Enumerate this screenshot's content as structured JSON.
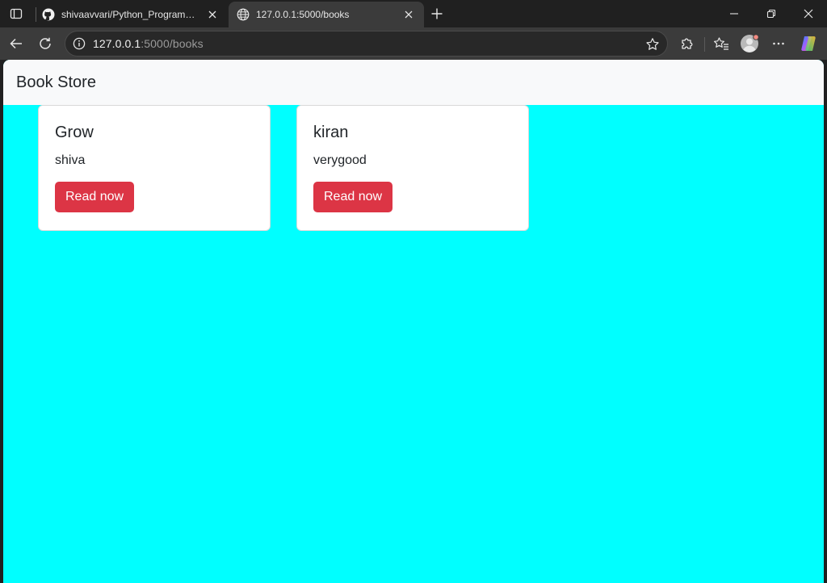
{
  "browser": {
    "tabs": [
      {
        "title": "shivaavvari/Python_Programming",
        "icon": "github-icon",
        "active": false
      },
      {
        "title": "127.0.0.1:5000/books",
        "icon": "globe-icon",
        "active": true
      }
    ],
    "address": {
      "host": "127.0.0.1",
      "path": ":5000/books"
    },
    "colors": {
      "chrome": "#202020",
      "toolbar": "#3b3b3b",
      "profile_badge": "#f28b82"
    }
  },
  "page": {
    "brand": "Book Store",
    "background": "#00ffff",
    "books": [
      {
        "title": "Grow",
        "description": "shiva",
        "button": "Read now"
      },
      {
        "title": "kiran",
        "description": "verygood",
        "button": "Read now"
      }
    ],
    "button_color": "#dc3545"
  }
}
